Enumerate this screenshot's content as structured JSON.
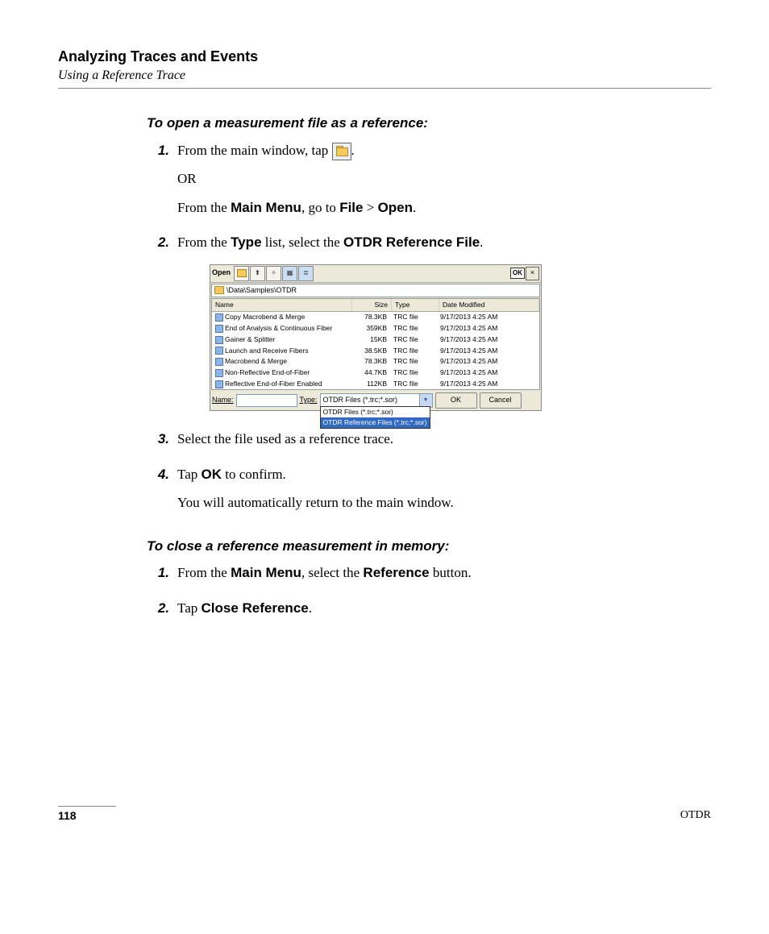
{
  "chapter": "Analyzing Traces and Events",
  "section": "Using a Reference Trace",
  "proc1": {
    "heading": "To open a measurement file as a reference:",
    "step1_a": "From the main window, tap ",
    "step1_b": ".",
    "step1_or": "OR",
    "step1_c_pre": "From the ",
    "step1_c_b1": "Main Menu",
    "step1_c_mid": ", go to ",
    "step1_c_b2": "File",
    "step1_c_gt": " > ",
    "step1_c_b3": "Open",
    "step1_c_post": ".",
    "step2_pre": "From the ",
    "step2_b1": "Type",
    "step2_mid": " list, select the ",
    "step2_b2": "OTDR Reference File",
    "step2_post": ".",
    "step3": "Select the file used as a reference trace.",
    "step4_pre": "Tap ",
    "step4_b": "OK",
    "step4_post": " to confirm.",
    "step4_after": "You will automatically return to the main window."
  },
  "proc2": {
    "heading": "To close a reference measurement in memory:",
    "step1_pre": "From the ",
    "step1_b1": "Main Menu",
    "step1_mid": ", select the ",
    "step1_b2": "Reference",
    "step1_post": " button.",
    "step2_pre": "Tap ",
    "step2_b": "Close Reference",
    "step2_post": "."
  },
  "nums": {
    "n1": "1.",
    "n2": "2.",
    "n3": "3.",
    "n4": "4."
  },
  "dialog": {
    "title": "Open",
    "ok_small": "OK",
    "close_x": "×",
    "path": "\\Data\\Samples\\OTDR",
    "columns": {
      "name": "Name",
      "size": "Size",
      "type": "Type",
      "date": "Date Modified"
    },
    "rows": [
      {
        "name": "Copy Macrobend & Merge",
        "size": "78.3KB",
        "type": "TRC file",
        "date": "9/17/2013 4:25 AM"
      },
      {
        "name": "End of Analysis & Continuous Fiber",
        "size": "359KB",
        "type": "TRC file",
        "date": "9/17/2013 4:25 AM"
      },
      {
        "name": "Gainer & Splitter",
        "size": "15KB",
        "type": "TRC file",
        "date": "9/17/2013 4:25 AM"
      },
      {
        "name": "Launch and Receive Fibers",
        "size": "38.5KB",
        "type": "TRC file",
        "date": "9/17/2013 4:25 AM"
      },
      {
        "name": "Macrobend & Merge",
        "size": "78.3KB",
        "type": "TRC file",
        "date": "9/17/2013 4:25 AM"
      },
      {
        "name": "Non-Reflective End-of-Fiber",
        "size": "44.7KB",
        "type": "TRC file",
        "date": "9/17/2013 4:25 AM"
      },
      {
        "name": "Reflective End-of-Fiber Enabled",
        "size": "112KB",
        "type": "TRC file",
        "date": "9/17/2013 4:25 AM"
      }
    ],
    "name_label": "Name:",
    "type_label": "Type:",
    "type_current": "OTDR Files (*.trc;*.sor)",
    "dropdown": {
      "opt1": "OTDR Files (*.trc;*.sor)",
      "opt2": "OTDR Reference Files (*.trc;*.sor)"
    },
    "btn_ok": "OK",
    "btn_cancel": "Cancel"
  },
  "footer": {
    "page": "118",
    "doc": "OTDR"
  }
}
